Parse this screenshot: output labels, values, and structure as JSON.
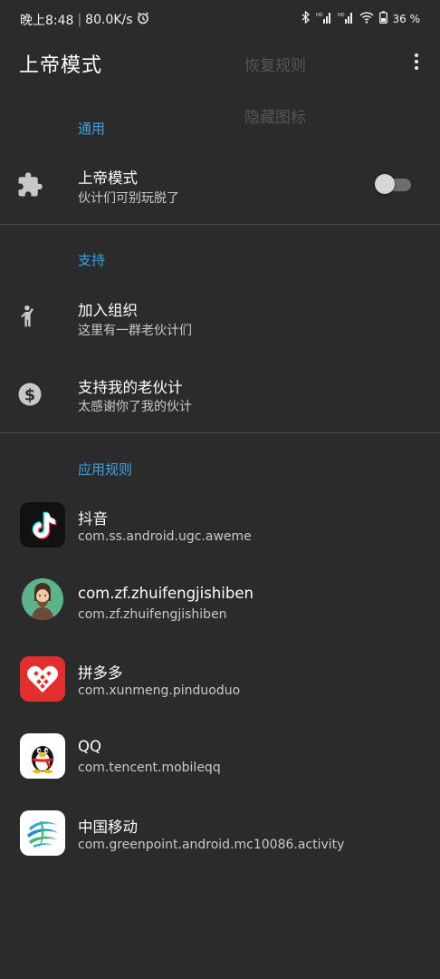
{
  "status_bar": {
    "time": "晚上8:48",
    "speed": "80.0K/s",
    "battery": "36 %"
  },
  "app_bar": {
    "title": "上帝模式",
    "overflow_menu": [
      "恢复规则",
      "隐藏图标"
    ]
  },
  "sections": {
    "general": {
      "header": "通用",
      "god_mode": {
        "title": "上帝模式",
        "subtitle": "伙计们可别玩脱了",
        "enabled": false
      }
    },
    "support": {
      "header": "支持",
      "join": {
        "title": "加入组织",
        "subtitle": "这里有一群老伙计们"
      },
      "donate": {
        "title": "支持我的老伙计",
        "subtitle": "太感谢你了我的伙计"
      }
    },
    "rules": {
      "header": "应用规则",
      "apps": [
        {
          "name": "抖音",
          "package": "com.ss.android.ugc.aweme",
          "icon": "tiktok-icon"
        },
        {
          "name": "com.zf.zhuifengjishiben",
          "package": "com.zf.zhuifengjishiben",
          "icon": "avatar-man-icon"
        },
        {
          "name": "拼多多",
          "package": "com.xunmeng.pinduoduo",
          "icon": "pinduoduo-icon"
        },
        {
          "name": "QQ",
          "package": "com.tencent.mobileqq",
          "icon": "qq-penguin-icon"
        },
        {
          "name": "中国移动",
          "package": "com.greenpoint.android.mc10086.activity",
          "icon": "china-mobile-icon"
        }
      ]
    }
  },
  "colors": {
    "background": "#2b2b2c",
    "accent": "#3aa3e6",
    "ghost_text": "#55565a"
  }
}
